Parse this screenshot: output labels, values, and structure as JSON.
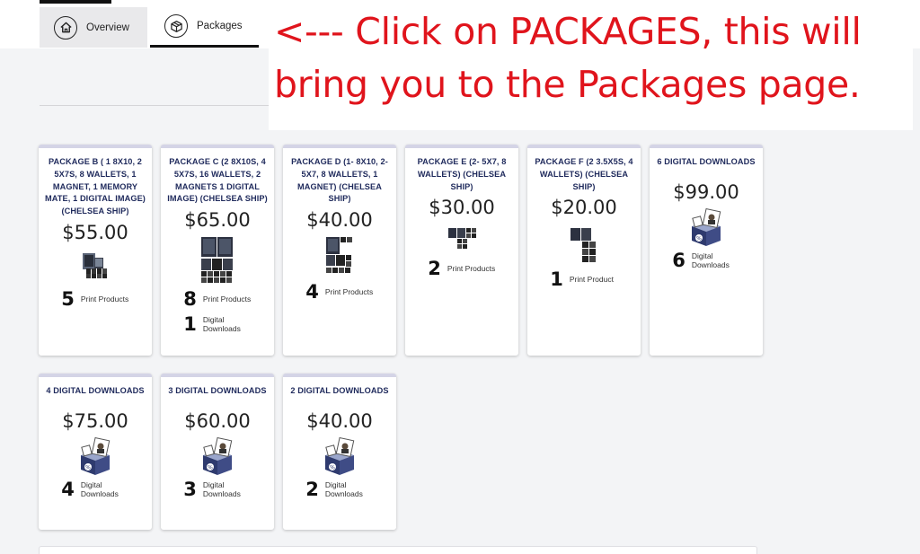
{
  "tabs": {
    "overview_label": "Overview",
    "overview_icon": "home-icon",
    "packages_label": "Packages",
    "packages_icon": "box-icon"
  },
  "annotation": {
    "line1": "<--- Click on PACKAGES, this will",
    "line2": "bring you to the Packages page.",
    "color": "#e0141c"
  },
  "packages": [
    {
      "title": "PACKAGE B ( 1 8X10, 2 5X7S, 8 WALLETS, 1 MAGNET, 1 MEMORY MATE, 1 DIGITAL IMAGE) (CHELSEA SHIP)",
      "price": "$55.00",
      "image": "print-products-thumbnail",
      "counts": [
        {
          "num": "5",
          "label": "Print Products"
        }
      ]
    },
    {
      "title": "PACKAGE C (2 8X10S, 4 5X7S, 16 WALLETS, 2 MAGNETS 1 DIGITAL IMAGE) (CHELSEA SHIP)",
      "price": "$65.00",
      "image": "print-products-thumbnail",
      "counts": [
        {
          "num": "8",
          "label": "Print Products"
        },
        {
          "num": "1",
          "label": "Digital Downloads"
        }
      ]
    },
    {
      "title": "PACKAGE D (1- 8X10, 2- 5X7, 8 WALLETS, 1 MAGNET) (CHELSEA SHIP)",
      "price": "$40.00",
      "image": "print-products-thumbnail",
      "counts": [
        {
          "num": "4",
          "label": "Print Products"
        }
      ]
    },
    {
      "title": "PACKAGE E (2- 5X7, 8 WALLETS) (CHELSEA SHIP)",
      "price": "$30.00",
      "image": "print-products-thumbnail",
      "counts": [
        {
          "num": "2",
          "label": "Print Products"
        }
      ]
    },
    {
      "title": "PACKAGE F (2 3.5X5S, 4 WALLETS) (CHELSEA SHIP)",
      "price": "$20.00",
      "image": "print-products-thumbnail",
      "counts": [
        {
          "num": "1",
          "label": "Print Product"
        }
      ]
    },
    {
      "title": "6 DIGITAL DOWNLOADS",
      "price": "$99.00",
      "image": "digital-download-box",
      "counts": [
        {
          "num": "6",
          "label": "Digital Downloads"
        }
      ]
    },
    {
      "title": "4 DIGITAL DOWNLOADS",
      "price": "$75.00",
      "image": "digital-download-box",
      "counts": [
        {
          "num": "4",
          "label": "Digital Downloads"
        }
      ]
    },
    {
      "title": "3 DIGITAL DOWNLOADS",
      "price": "$60.00",
      "image": "digital-download-box",
      "counts": [
        {
          "num": "3",
          "label": "Digital Downloads"
        }
      ]
    },
    {
      "title": "2 DIGITAL DOWNLOADS",
      "price": "$40.00",
      "image": "digital-download-box",
      "counts": [
        {
          "num": "2",
          "label": "Digital Downloads"
        }
      ]
    }
  ]
}
